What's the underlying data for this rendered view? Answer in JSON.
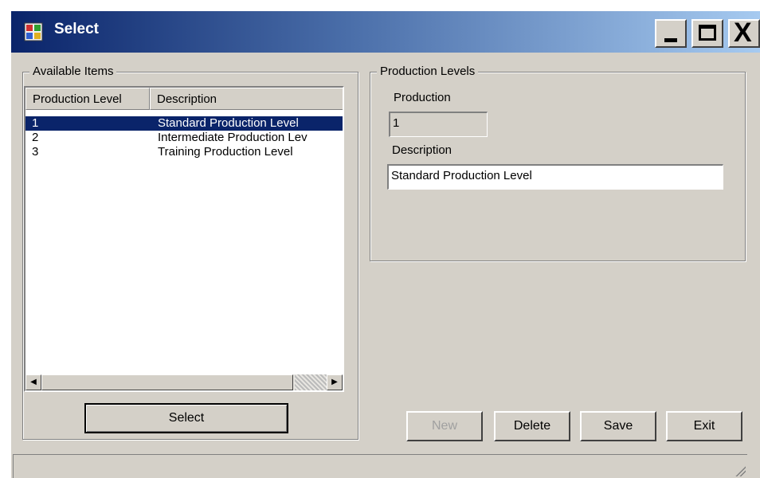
{
  "window": {
    "title": "Select"
  },
  "caption_buttons": {
    "minimize": "_",
    "maximize": "□",
    "close": "X"
  },
  "available_items": {
    "group_label": "Available Items",
    "columns": [
      "Production Level",
      "Description"
    ],
    "rows": [
      {
        "level": "1",
        "description": "Standard Production Level",
        "selected": true
      },
      {
        "level": "2",
        "description": "Intermediate Production Lev",
        "selected": false
      },
      {
        "level": "3",
        "description": "Training Production Level",
        "selected": false
      }
    ],
    "select_label": "Select"
  },
  "production_levels": {
    "group_label": "Production Levels",
    "production_label": "Production",
    "production_value": "1",
    "description_label": "Description",
    "description_value": "Standard Production Level"
  },
  "buttons": {
    "new": "New",
    "delete": "Delete",
    "save": "Save",
    "exit": "Exit"
  },
  "status_bar": {
    "text": ""
  },
  "colors": {
    "selection": "#0a246a",
    "title_start": "#0a246a",
    "title_end": "#a6caf0",
    "face": "#d4d0c8"
  }
}
